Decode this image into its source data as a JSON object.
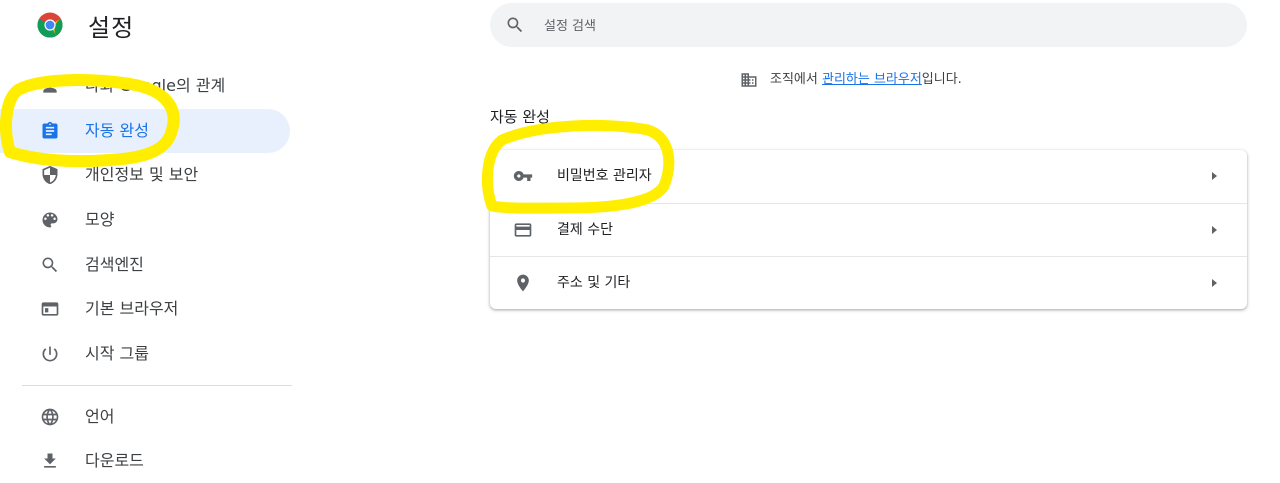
{
  "header": {
    "title": "설정",
    "logo_icon": "chrome-logo-icon"
  },
  "search": {
    "placeholder": "설정 검색",
    "icon": "search-icon"
  },
  "sidebar": {
    "items": [
      {
        "label": "나와 Google의 관계",
        "icon": "person-icon",
        "active": false
      },
      {
        "label": "자동 완성",
        "icon": "assignment-icon",
        "active": true
      },
      {
        "label": "개인정보 및 보안",
        "icon": "shield-icon",
        "active": false
      },
      {
        "label": "모양",
        "icon": "palette-icon",
        "active": false
      },
      {
        "label": "검색엔진",
        "icon": "search-icon",
        "active": false
      },
      {
        "label": "기본 브라우저",
        "icon": "browser-window-icon",
        "active": false
      },
      {
        "label": "시작 그룹",
        "icon": "power-icon",
        "active": false
      },
      {
        "label": "언어",
        "icon": "globe-icon",
        "active": false
      },
      {
        "label": "다운로드",
        "icon": "download-icon",
        "active": false
      }
    ]
  },
  "managed": {
    "prefix": "조직에서 ",
    "link": "관리하는 브라우저",
    "suffix": "입니다.",
    "icon": "building-icon"
  },
  "main": {
    "section_title": "자동 완성",
    "rows": [
      {
        "label": "비밀번호 관리자",
        "icon": "key-icon"
      },
      {
        "label": "결제 수단",
        "icon": "credit-card-icon"
      },
      {
        "label": "주소 및 기타",
        "icon": "location-pin-icon"
      }
    ]
  },
  "colors": {
    "accent": "#1a73e8",
    "active_bg": "#e8f0fe",
    "icon": "#5f6368",
    "highlighter": "#ffee00"
  }
}
